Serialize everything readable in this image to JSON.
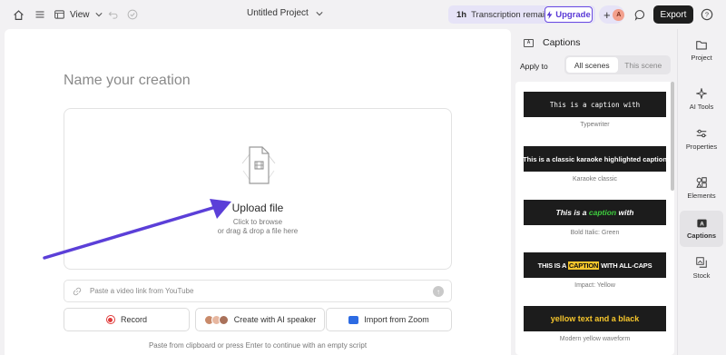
{
  "topbar": {
    "view_label": "View",
    "project_title": "Untitled Project",
    "transcription_hours": "1h",
    "transcription_text": "Transcription remaining",
    "upgrade_label": "Upgrade",
    "avatar_initial": "A",
    "export_label": "Export",
    "help_label": "?"
  },
  "main": {
    "name_placeholder": "Name your creation",
    "upload_title": "Upload file",
    "upload_sub1": "Click to browse",
    "upload_sub2": "or drag & drop a file here",
    "youtube_placeholder": "Paste a video link from YouTube",
    "record_label": "Record",
    "ai_speaker_label": "Create with AI speaker",
    "zoom_label": "Import from Zoom",
    "footnote": "Paste from clipboard or press Enter to continue with an empty script"
  },
  "captions": {
    "title": "Captions",
    "apply_to": "Apply to",
    "scope_options": [
      "All scenes",
      "This scene"
    ],
    "selected_scope": "All scenes",
    "styles": [
      {
        "preview": "This is a caption with",
        "label": "Typewriter"
      },
      {
        "preview": "This is a classic karaoke highlighted caption",
        "label": "Karaoke classic"
      },
      {
        "preview_pre": "This is a ",
        "preview_hl": "caption",
        "preview_post": " with",
        "label": "Bold Italic: Green"
      },
      {
        "preview_pre": "THIS IS A ",
        "preview_hl": "CAPTION",
        "preview_post": " WITH ALL-CAPS",
        "label": "Impact: Yellow"
      },
      {
        "preview": "yellow text and a black",
        "label": "Modern yellow waveform"
      }
    ]
  },
  "rail": {
    "items": [
      {
        "label": "Project",
        "icon": "folder-icon"
      },
      {
        "label": "AI Tools",
        "icon": "sparkle-icon"
      },
      {
        "label": "Properties",
        "icon": "sliders-icon"
      },
      {
        "label": "Elements",
        "icon": "shapes-icon"
      },
      {
        "label": "Captions",
        "icon": "captions-icon"
      },
      {
        "label": "Stock",
        "icon": "stock-media-icon"
      }
    ],
    "active": "Captions"
  },
  "colors": {
    "accent": "#5a3ad6",
    "arrow": "#5b3fd8",
    "record": "#e03a3a",
    "green_highlight": "#3fd13f",
    "yellow_highlight": "#f6c62c"
  }
}
